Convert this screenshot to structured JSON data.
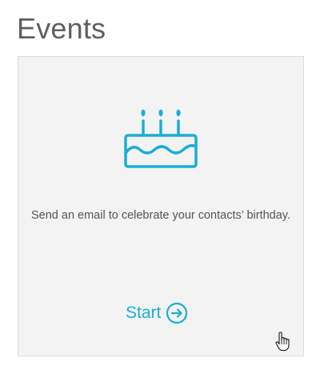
{
  "page": {
    "title": "Events"
  },
  "card": {
    "icon": "birthday-cake-icon",
    "description": "Send an email to celebrate your contacts’ birthday.",
    "action_label": "Start",
    "action_icon": "arrow-right-circle-icon"
  },
  "colors": {
    "accent": "#1aaed6",
    "card_background": "#f3f3f3",
    "title_text": "#5f5f5f",
    "body_text": "#555555"
  }
}
